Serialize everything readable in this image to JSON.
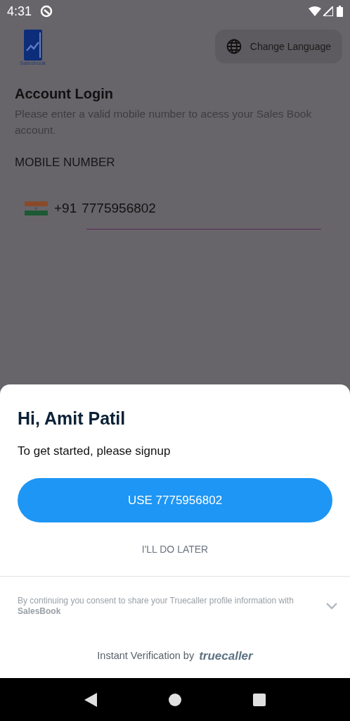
{
  "status_bar": {
    "time": "4:31"
  },
  "header": {
    "logo_caption": "Salesbook",
    "language_button": "Change Language"
  },
  "login": {
    "title": "Account Login",
    "subtitle": "Please enter a valid mobile number to acess your Sales Book account.",
    "field_label": "MOBILE NUMBER",
    "country_code": "+91",
    "phone": "7775956802"
  },
  "sheet": {
    "greeting": "Hi, Amit Patil",
    "prompt": "To get started, please signup",
    "primary_button": "USE 7775956802",
    "secondary_button": "I'LL DO LATER",
    "consent": "By continuing you consent to share your Truecaller profile information with **SalesBook**",
    "footer": "Instant Verification by",
    "brand": "truecaller"
  }
}
